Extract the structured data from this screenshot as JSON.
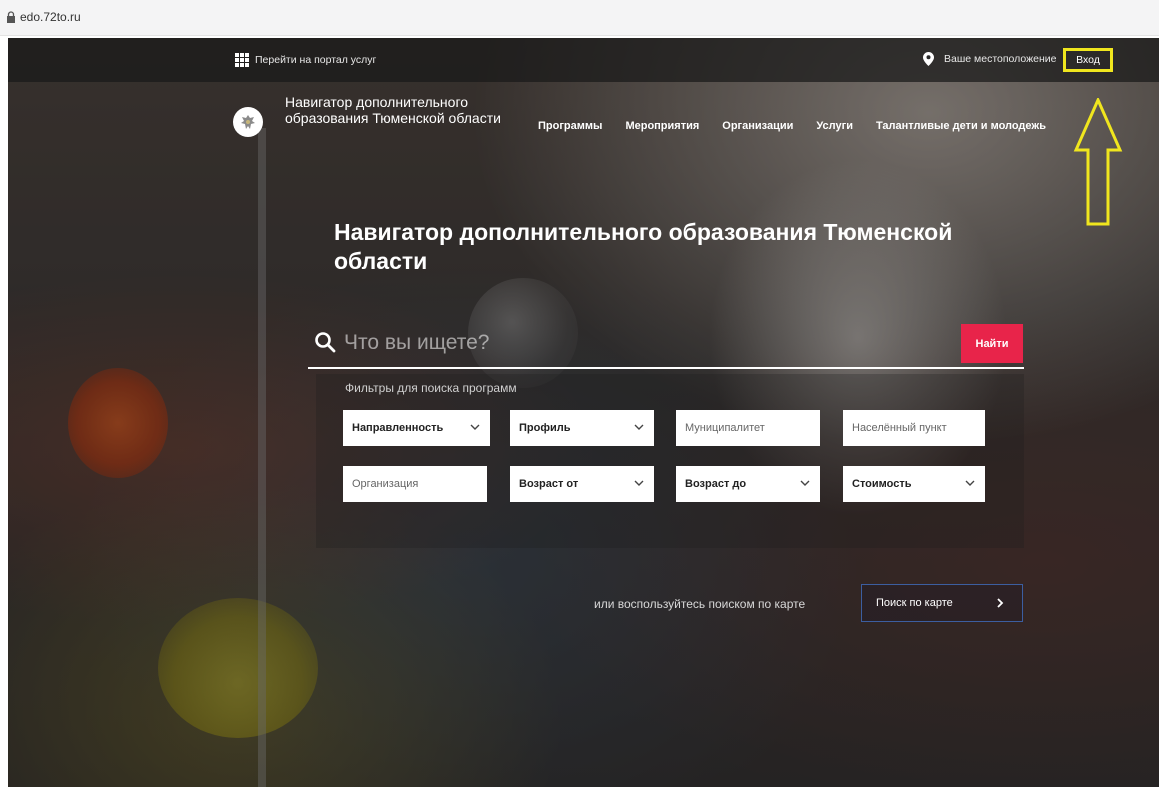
{
  "browser": {
    "url": "edo.72to.ru"
  },
  "topbar": {
    "portal_link": "Перейти на портал услуг",
    "location": "Ваше местоположение",
    "login": "Вход"
  },
  "header": {
    "site_name": "Навигатор дополнительного образования Тюменской области",
    "nav": [
      "Программы",
      "Мероприятия",
      "Организации",
      "Услуги",
      "Талантливые дети и молодежь"
    ]
  },
  "hero": {
    "title": "Навигатор дополнительного образования Тюменской области"
  },
  "search": {
    "placeholder": "Что вы ищете?",
    "button": "Найти",
    "filters_caption": "Фильтры для поиска программ"
  },
  "filters": {
    "row1": [
      "Направленность",
      "Профиль",
      "Муниципалитет",
      "Населённый пункт"
    ],
    "row2": [
      "Организация",
      "Возраст от",
      "Возраст до",
      "Стоимость"
    ]
  },
  "map": {
    "text": "или воспользуйтесь поиском по карте",
    "button": "Поиск по карте"
  },
  "colors": {
    "accent": "#e8244a",
    "annotation": "#f0e61e",
    "map_border": "#3c5ea0"
  }
}
